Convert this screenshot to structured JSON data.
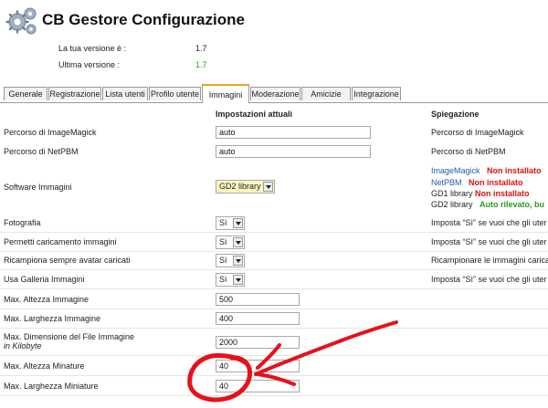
{
  "header": {
    "title": "CB Gestore Configurazione",
    "current_version_label": "La tua versione è :",
    "current_version_value": "1.7",
    "latest_version_label": "Ultima versione :",
    "latest_version_value": "1.7",
    "latest_version_color": "#2a9a1e"
  },
  "tabs": [
    {
      "label": "Generale"
    },
    {
      "label": "Registrazione"
    },
    {
      "label": "Lista utenti"
    },
    {
      "label": "Profilo utente"
    },
    {
      "label": "Immagini",
      "active": true
    },
    {
      "label": "Moderazione"
    },
    {
      "label": "Amicizie"
    },
    {
      "label": "Integrazione"
    }
  ],
  "columns": {
    "current": "Impostazioni attuali",
    "explanation": "Spiegazione"
  },
  "rows": {
    "imagemagick_path": {
      "label": "Percorso di ImageMagick",
      "value": "auto",
      "desc": "Percorso di ImageMagick"
    },
    "netpbm_path": {
      "label": "Percorso di NetPBM",
      "value": "auto",
      "desc": "Percorso di NetPBM"
    },
    "software": {
      "label": "Software Immagini",
      "value": "GD2 library",
      "status": [
        {
          "name": "ImageMagick",
          "state": "Non installato"
        },
        {
          "name": "NetPBM",
          "state": "Non installato"
        },
        {
          "name": "GD1 library",
          "state": "Non installato"
        },
        {
          "name": "GD2 library",
          "state": "Auto rilevato, bu"
        }
      ]
    },
    "photo": {
      "label": "Fotografia",
      "value": "Sì",
      "desc": "Imposta “Sì” se vuoi che gli uter"
    },
    "allow_upload": {
      "label": "Permetti caricamento immagini",
      "value": "Sì",
      "desc": "Imposta “Sì” se vuoi che gli uter"
    },
    "resample_avatars": {
      "label": "Ricampiona sempre avatar caricati",
      "value": "Sì",
      "desc": "Ricampionare le immagini caricat"
    },
    "use_gallery": {
      "label": "Usa Galleria Immagini",
      "value": "Sì",
      "desc": "Imposta “Sì” se vuoi che gli uter"
    },
    "max_height": {
      "label": "Max. Altezza Immagine",
      "value": "500"
    },
    "max_width": {
      "label": "Max. Larghezza Immagine",
      "value": "400"
    },
    "max_filesize": {
      "label": "Max. Dimensione del File Immagine",
      "sublabel": "in Kilobyte",
      "value": "2000"
    },
    "thumb_height": {
      "label": "Max. Altezza Minature",
      "value": "40"
    },
    "thumb_width": {
      "label": "Max. Larghezza Miniature",
      "value": "40"
    }
  },
  "annotation_color": "#e8101a"
}
